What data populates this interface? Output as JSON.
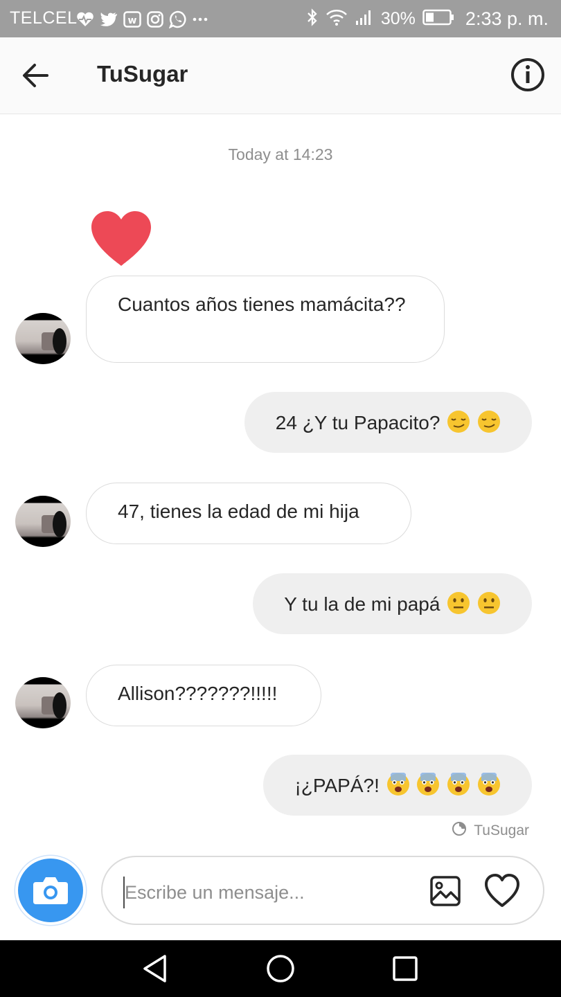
{
  "status_bar": {
    "carrier": "TELCEL",
    "left_icons": [
      "heart-rate-icon",
      "twitter-icon",
      "app-badge-icon",
      "instagram-icon",
      "whatsapp-icon",
      "more-dots-icon"
    ],
    "right_icons": [
      "bluetooth-icon",
      "wifi-icon",
      "signal-icon",
      "battery-icon"
    ],
    "battery_percent": "30%",
    "time": "2:33 p. m."
  },
  "header": {
    "title": "TuSugar",
    "back_icon": "arrow-left-icon",
    "info_icon": "info-circle-icon"
  },
  "chat": {
    "timestamp": "Today at 14:23",
    "reaction_icon": "red-heart-icon",
    "messages": [
      {
        "direction": "incoming",
        "text": "Cuantos años tienes mamácita??",
        "emojis": []
      },
      {
        "direction": "outgoing",
        "text": "24 ¿Y tu Papacito?",
        "emojis": [
          "smirk-emoji",
          "smirk-emoji"
        ]
      },
      {
        "direction": "incoming",
        "text": "47, tienes la edad de mi hija",
        "emojis": []
      },
      {
        "direction": "outgoing",
        "text": "Y tu la de mi papá",
        "emojis": [
          "neutral-face-emoji",
          "neutral-face-emoji"
        ]
      },
      {
        "direction": "incoming",
        "text": "Allison???????!!!!!",
        "emojis": []
      },
      {
        "direction": "outgoing",
        "text": "¡¿PAPÁ?!",
        "emojis": [
          "fearful-face-emoji",
          "fearful-face-emoji",
          "fearful-face-emoji",
          "fearful-face-emoji"
        ]
      }
    ],
    "seen_by": "TuSugar",
    "seen_icon": "eye-icon"
  },
  "composer": {
    "placeholder": "Escribe un mensaje...",
    "value": "",
    "camera_icon": "camera-icon",
    "gallery_icon": "image-icon",
    "like_icon": "heart-outline-icon"
  },
  "nav_bar": {
    "icons": [
      "back-triangle-icon",
      "home-circle-icon",
      "recents-square-icon"
    ]
  },
  "colors": {
    "accent": "#3897f0",
    "heart": "#ed4956",
    "status_bar": "#9e9e9e",
    "outgoing_bubble": "#efefef"
  }
}
